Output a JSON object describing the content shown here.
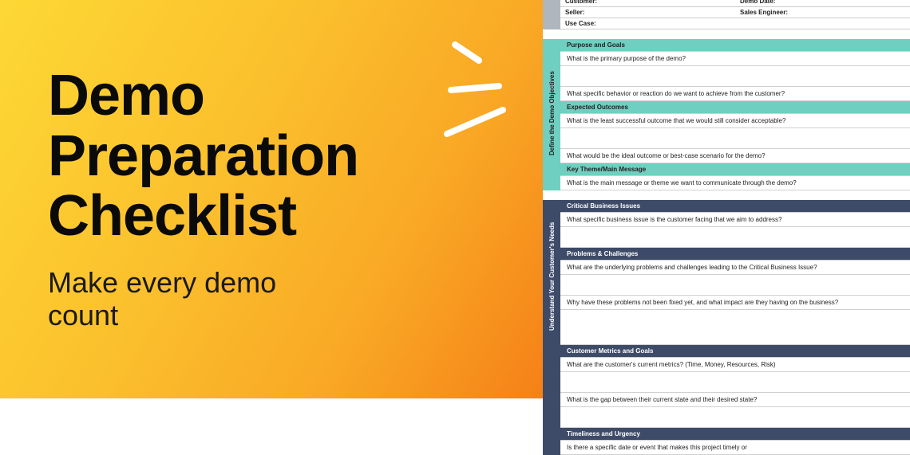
{
  "hero": {
    "title_l1": "Demo",
    "title_l2": "Preparation",
    "title_l3": "Checklist",
    "subtitle_l1": "Make every demo",
    "subtitle_l2": "count"
  },
  "doc": {
    "top_fields": {
      "customer": "Customer:",
      "demo_date": "Demo Date:",
      "seller": "Seller:",
      "sales_engineer": "Sales Engineer:",
      "use_case": "Use Case:"
    },
    "section1": {
      "vlabel": "Define the Demo Objectives",
      "h1": "Purpose and Goals",
      "q1": "What is the primary purpose of the demo?",
      "q2": "What specific behavior or reaction do we want to achieve from the customer?",
      "h2": "Expected Outcomes",
      "q3": "What is the least successful outcome that we would still consider acceptable?",
      "q4": "What would be the ideal outcome or best-case scenario for the demo?",
      "h3": "Key Theme/Main Message",
      "q5": "What is the main message or theme we want to communicate through the demo?"
    },
    "section2": {
      "vlabel": "Understand Your Customer's Needs",
      "h1": "Critical Business Issues",
      "q1": "What specific business issue is the customer facing that we aim to address?",
      "h2": "Problems & Challenges",
      "q2": "What are the underlying problems and challenges leading to the Critical Business Issue?",
      "q3": "Why have these problems not been fixed yet, and what impact are they having on the business?",
      "h3": "Customer Metrics and Goals",
      "q4": "What are the customer's current metrics? (Time, Money, Resources, Risk)",
      "q5": "What is the gap between their current state and their desired state?",
      "h4": "Timeliness and Urgency",
      "q6": "Is there a specific date or event that makes this project timely or"
    }
  }
}
